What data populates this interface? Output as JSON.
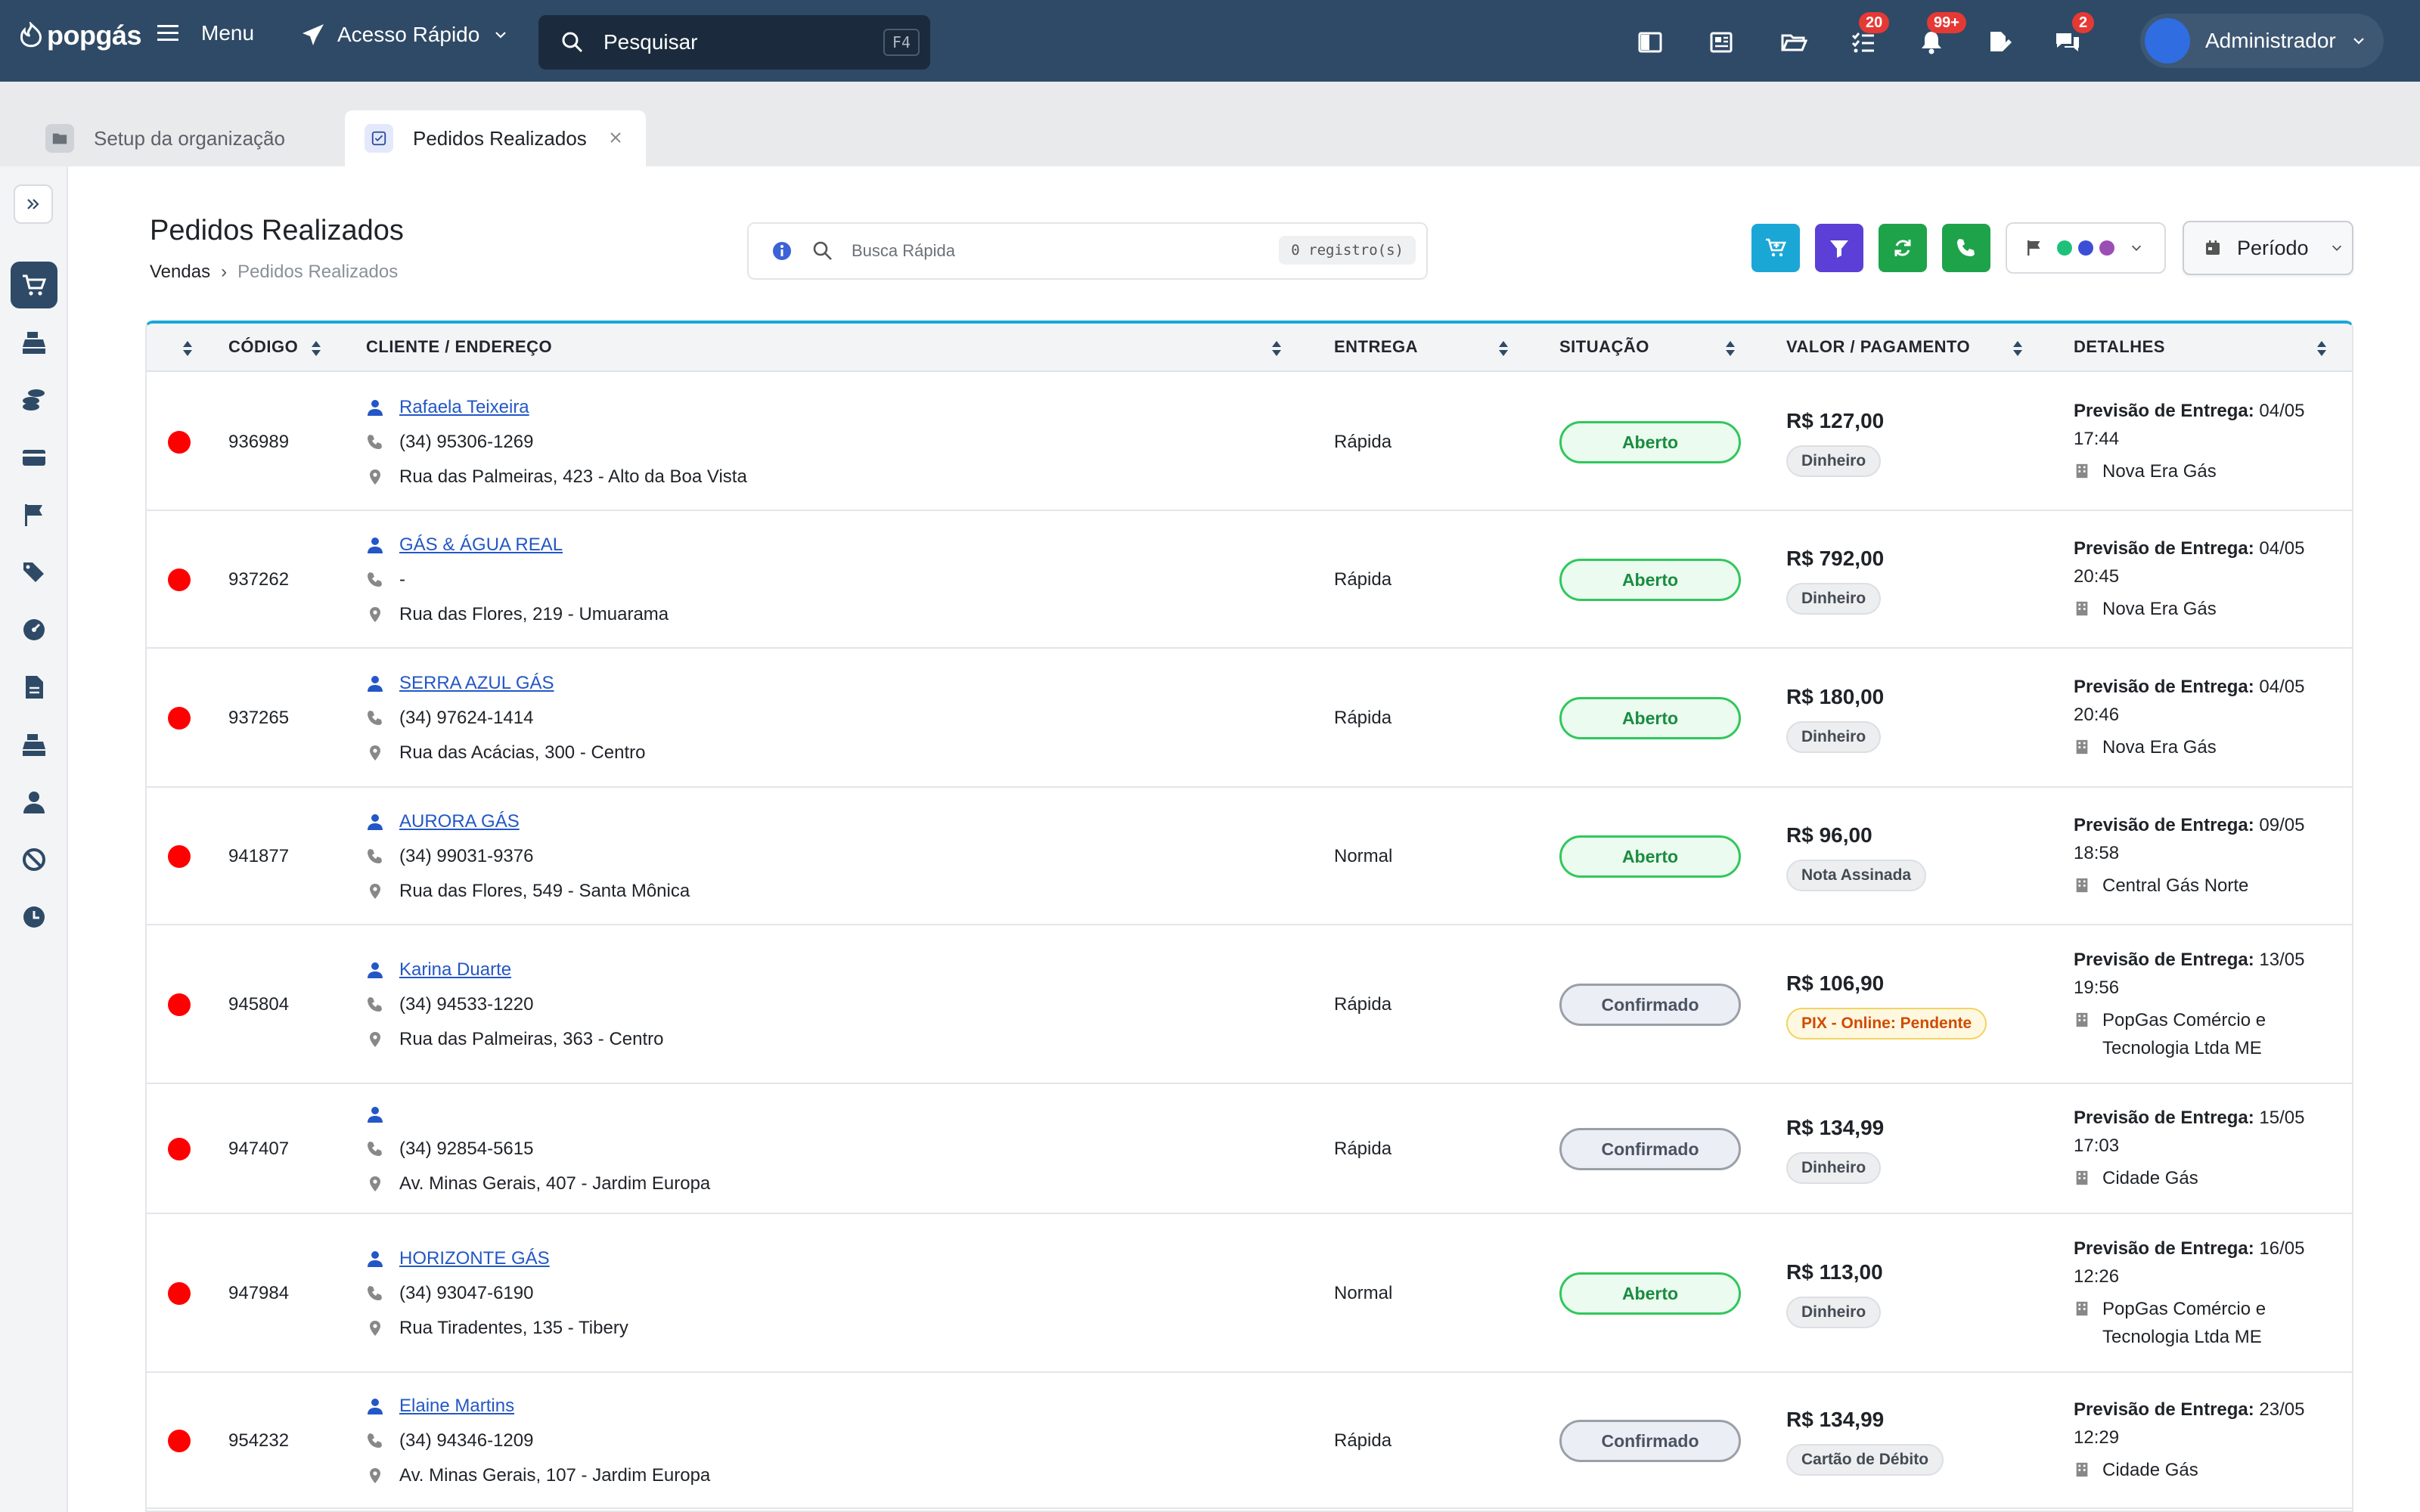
{
  "topbar": {
    "logo": "popgás",
    "menu_label": "Menu",
    "quick_access_label": "Acesso Rápido",
    "search_label": "Pesquisar",
    "search_shortcut": "F4",
    "badges": {
      "tasks": "20",
      "notifications": "99+",
      "messages": "2"
    },
    "user_name": "Administrador"
  },
  "tabs": [
    {
      "label": "Setup da organização"
    },
    {
      "label": "Pedidos Realizados"
    }
  ],
  "page": {
    "title": "Pedidos Realizados",
    "breadcrumb_root": "Vendas",
    "breadcrumb_sep": "›",
    "breadcrumb_current": "Pedidos Realizados",
    "quick_search_placeholder": "Busca Rápida",
    "records_count": "0 registro(s)",
    "period_label": "Período",
    "flag_colors": [
      "#1fc17a",
      "#3b4fd6",
      "#9b4fb4"
    ]
  },
  "table": {
    "columns": [
      "CÓDIGO",
      "CLIENTE / ENDEREÇO",
      "ENTREGA",
      "SITUAÇÃO",
      "VALOR / PAGAMENTO",
      "DETALHES"
    ],
    "details_prefix": "Previsão de Entrega:",
    "rows": [
      {
        "code": "936989",
        "client": "Rafaela Teixeira",
        "phone": "(34) 95306-1269",
        "address": "Rua das Palmeiras, 423 - Alto da Boa Vista",
        "delivery": "Rápida",
        "status": "Aberto",
        "value": "R$ 127,00",
        "payment": "Dinheiro",
        "date": " 04/05",
        "time": "17:44",
        "company": "Nova Era Gás"
      },
      {
        "code": "937262",
        "client": "GÁS & ÁGUA REAL",
        "phone": "-",
        "address": "Rua das Flores, 219 - Umuarama",
        "delivery": "Rápida",
        "status": "Aberto",
        "value": "R$ 792,00",
        "payment": "Dinheiro",
        "date": " 04/05",
        "time": "20:45",
        "company": "Nova Era Gás"
      },
      {
        "code": "937265",
        "client": "SERRA AZUL GÁS",
        "phone": "(34) 97624-1414",
        "address": "Rua das Acácias, 300 - Centro",
        "delivery": "Rápida",
        "status": "Aberto",
        "value": "R$ 180,00",
        "payment": "Dinheiro",
        "date": " 04/05",
        "time": "20:46",
        "company": "Nova Era Gás"
      },
      {
        "code": "941877",
        "client": "AURORA GÁS",
        "phone": "(34) 99031-9376",
        "address": "Rua das Flores, 549 - Santa Mônica",
        "delivery": "Normal",
        "status": "Aberto",
        "value": "R$ 96,00",
        "payment": "Nota Assinada",
        "date": " 09/05",
        "time": "18:58",
        "company": "Central Gás Norte"
      },
      {
        "code": "945804",
        "client": "Karina Duarte",
        "phone": "(34) 94533-1220",
        "address": "Rua das Palmeiras, 363 - Centro",
        "delivery": "Rápida",
        "status": "Confirmado",
        "value": "R$ 106,90",
        "payment": "PIX - Online: Pendente",
        "date": " 13/05",
        "time": "19:56",
        "company": "PopGas Comércio e Tecnologia Ltda ME"
      },
      {
        "code": "947407",
        "client": "",
        "phone": "(34) 92854-5615",
        "address": "Av. Minas Gerais, 407 - Jardim Europa",
        "delivery": "Rápida",
        "status": "Confirmado",
        "value": "R$ 134,99",
        "payment": "Dinheiro",
        "date": " 15/05",
        "time": "17:03",
        "company": "Cidade Gás"
      },
      {
        "code": "947984",
        "client": "HORIZONTE GÁS",
        "phone": "(34) 93047-6190",
        "address": "Rua Tiradentes, 135 - Tibery",
        "delivery": "Normal",
        "status": "Aberto",
        "value": "R$ 113,00",
        "payment": "Dinheiro",
        "date": " 16/05",
        "time": "12:26",
        "company": "PopGas Comércio e Tecnologia Ltda ME"
      },
      {
        "code": "954232",
        "client": "Elaine Martins",
        "phone": "(34) 94346-1209",
        "address": "Av. Minas Gerais, 107 - Jardim Europa",
        "delivery": "Rápida",
        "status": "Confirmado",
        "value": "R$ 134,99",
        "payment": "Cartão de Débito",
        "date": " 23/05",
        "time": "12:29",
        "company": "Cidade Gás"
      }
    ]
  }
}
